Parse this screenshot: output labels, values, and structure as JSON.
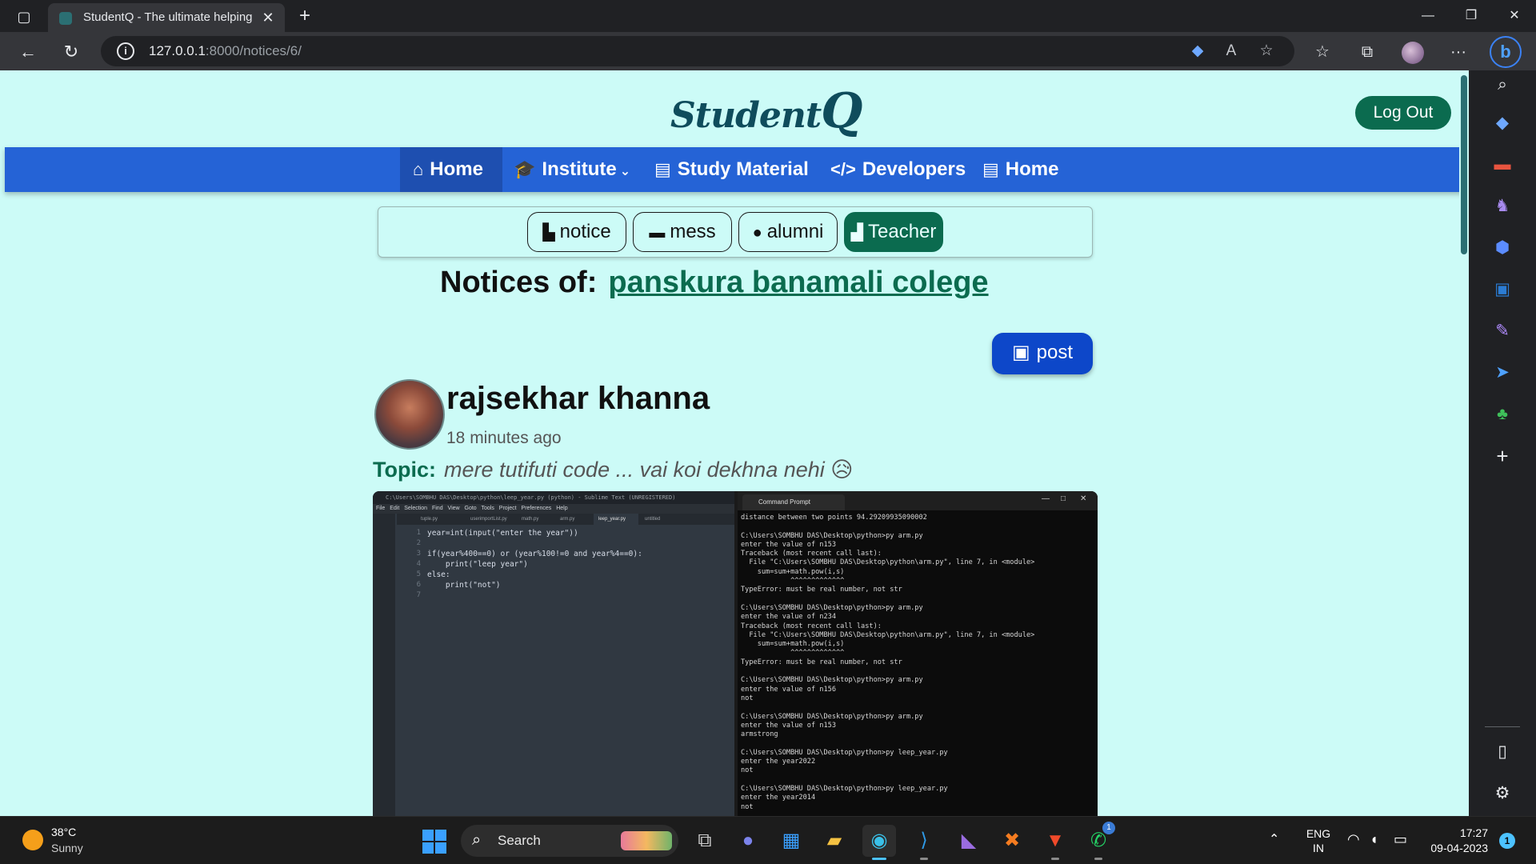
{
  "browser": {
    "tab_title": "StudentQ - The ultimate helping",
    "url_host": "127.0.0.1",
    "url_path": ":8000/notices/6/"
  },
  "site": {
    "brand_text": "Student",
    "brand_q": "Q",
    "logout_label": "Log Out",
    "nav": [
      {
        "label": "Home",
        "icon": "home-icon"
      },
      {
        "label": "Institute",
        "icon": "graduation-cap-icon"
      },
      {
        "label": "Study Material",
        "icon": "book-icon"
      },
      {
        "label": "Developers",
        "icon": "code-icon"
      },
      {
        "label": "Home",
        "icon": "book-icon"
      }
    ],
    "subnav": [
      {
        "label": "notice",
        "icon": "file-icon"
      },
      {
        "label": "mess",
        "icon": "bed-icon"
      },
      {
        "label": "alumni",
        "icon": "user-icon"
      },
      {
        "label": "Teacher",
        "icon": "teacher-icon"
      }
    ],
    "notices_prefix": "Notices of:",
    "institute_name": "panskura banamali colege",
    "post_button_label": "post"
  },
  "post": {
    "author": "rajsekhar khanna",
    "time_ago": "18 minutes  ago",
    "topic_label": "Topic:",
    "topic_text": "mere tutifuti code ... vai koi dekhna nehi 😥",
    "image": {
      "editor_title": "C:\\Users\\SOMBHU DAS\\Desktop\\python\\leep_year.py (python) - Sublime Text (UNREGISTERED)",
      "editor_menu": "File Edit Selection Find View Goto Tools Project Preferences Help",
      "editor_tabs": [
        "tuple.py",
        "userimportList.py",
        "math.py",
        "arm.py",
        "leep_year.py",
        "untitled"
      ],
      "line_numbers": "1\n2\n3\n4\n5\n6\n7",
      "code": "year=int(input(\"enter the year\"))\n\nif(year%400==0) or (year%100!=0 and year%4==0):\n    print(\"leep year\")\nelse:\n    print(\"not\")\n",
      "cmd_tab_title": "Command Prompt",
      "cmd_output": "distance between two points 94.29209935090002\n\nC:\\Users\\SOMBHU DAS\\Desktop\\python>py arm.py\nenter the value of n153\nTraceback (most recent call last):\n  File \"C:\\Users\\SOMBHU DAS\\Desktop\\python\\arm.py\", line 7, in <module>\n    sum=sum+math.pow(i,s)\n            ^^^^^^^^^^^^^\nTypeError: must be real number, not str\n\nC:\\Users\\SOMBHU DAS\\Desktop\\python>py arm.py\nenter the value of n234\nTraceback (most recent call last):\n  File \"C:\\Users\\SOMBHU DAS\\Desktop\\python\\arm.py\", line 7, in <module>\n    sum=sum+math.pow(i,s)\n            ^^^^^^^^^^^^^\nTypeError: must be real number, not str\n\nC:\\Users\\SOMBHU DAS\\Desktop\\python>py arm.py\nenter the value of n156\nnot\n\nC:\\Users\\SOMBHU DAS\\Desktop\\python>py arm.py\nenter the value of n153\narmstrong\n\nC:\\Users\\SOMBHU DAS\\Desktop\\python>py leep_year.py\nenter the year2022\nnot\n\nC:\\Users\\SOMBHU DAS\\Desktop\\python>py leep_year.py\nenter the year2014\nnot"
    }
  },
  "taskbar": {
    "weather_temp": "38°C",
    "weather_desc": "Sunny",
    "search_label": "Search",
    "lang_line1": "ENG",
    "lang_line2": "IN",
    "time": "17:27",
    "date": "09-04-2023",
    "notification_count": "1",
    "whatsapp_badge": "1"
  },
  "colors": {
    "page_bg": "#ccfbf7",
    "navbar": "#2563d6",
    "accent_green": "#0b6b4f",
    "post_button": "#0d47c9"
  }
}
